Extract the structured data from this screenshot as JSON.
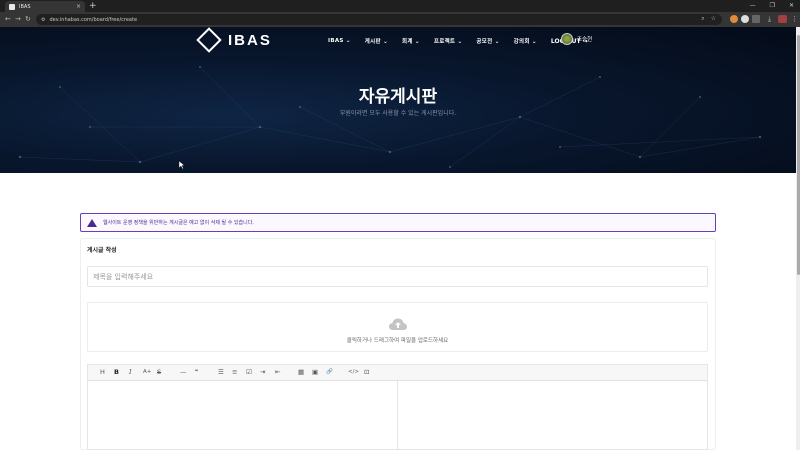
{
  "browser": {
    "tab_title": "IBAS",
    "url": "dev.inhabas.com/board/free/create"
  },
  "site": {
    "logo_text": "IBAS",
    "nav": [
      {
        "label": "IBAS ⌄"
      },
      {
        "label": "게시판 ⌄"
      },
      {
        "label": "회계 ⌄"
      },
      {
        "label": "프로젝트 ⌄"
      },
      {
        "label": "공모전 ⌄"
      },
      {
        "label": "강의회 ⌄"
      }
    ],
    "logout_label": "LOG OUT ↪",
    "user_name": "조승현"
  },
  "hero": {
    "title": "자유게시판",
    "subtitle": "부원이라면 모두 사용할 수 있는 게시판입니다."
  },
  "alert": {
    "text": "웹사이트 운영 정책을 위반하는 게시글은 예고 없이 삭제 될 수 있습니다."
  },
  "form": {
    "card_title": "게시글 작성",
    "title_placeholder": "제목을 입력해주세요",
    "upload_text": "클릭하거나 드래그하여 파일을 업로드하세요"
  },
  "toolbar": {
    "heading": "H",
    "bold": "B",
    "italic": "I",
    "font_size": "A+",
    "strike": "S",
    "hr": "—",
    "quote": "❝",
    "ul": "☰",
    "ol": "≡",
    "task": "☑",
    "indent": "⇥",
    "outdent": "⇤",
    "table": "▦",
    "image": "▣",
    "link": "🔗",
    "code": "</>",
    "codeblock": "⊡"
  }
}
